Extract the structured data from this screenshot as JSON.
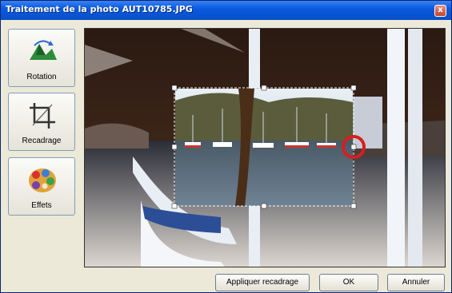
{
  "window": {
    "title": "Traitement de la photo AUT10785.JPG",
    "close_glyph": "x"
  },
  "tools": [
    {
      "label": "Rotation",
      "icon": "rotation-icon"
    },
    {
      "label": "Recadrage",
      "icon": "crop-icon"
    },
    {
      "label": "Effets",
      "icon": "palette-icon"
    }
  ],
  "buttons": {
    "apply_crop": "Appliquer recadrage",
    "ok": "OK",
    "cancel": "Annuler"
  },
  "colors": {
    "titlebar": "#0a5be0",
    "highlight": "#d61f1f"
  }
}
